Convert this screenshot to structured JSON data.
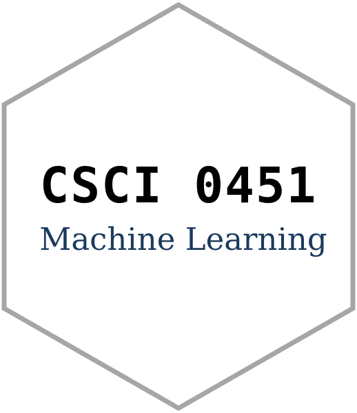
{
  "logo": {
    "course_code": "CSCI 0451",
    "course_title": "Machine Learning",
    "colors": {
      "hex_border": "#a6a6a6",
      "background": "#ffffff",
      "code_text": "#000000",
      "title_text": "#1b3a5c"
    }
  }
}
